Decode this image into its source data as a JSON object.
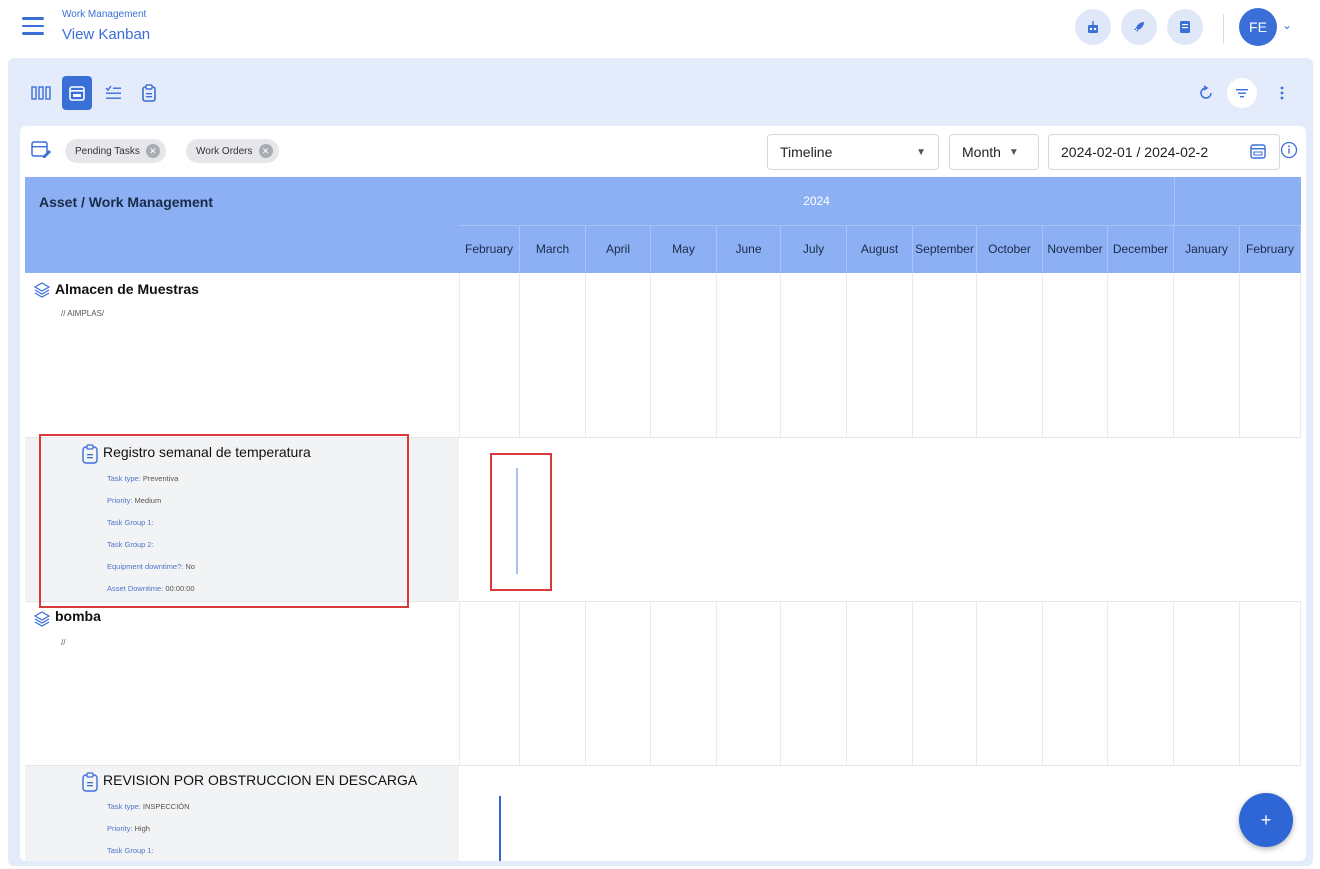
{
  "header": {
    "app_subtitle": "Work Management",
    "app_title": "View Kanban",
    "avatar_initials": "FE"
  },
  "filters": {
    "chips": [
      "Pending Tasks",
      "Work Orders"
    ],
    "view_select": "Timeline",
    "scale_select": "Month",
    "date_range": "2024-02-01 / 2024-02-2"
  },
  "grid": {
    "left_header": "Asset / Work Management",
    "year": "2024",
    "months": [
      "February",
      "March",
      "April",
      "May",
      "June",
      "July",
      "August",
      "September",
      "October",
      "November",
      "December",
      "January",
      "February"
    ]
  },
  "rows": {
    "asset1": {
      "name": "Almacen de Muestras",
      "path": "// AIMPLAS/"
    },
    "task1": {
      "name": "Registro semanal de temperatura",
      "details": [
        {
          "label": "Task type:",
          "value": "Preventiva"
        },
        {
          "label": "Priority:",
          "value": "Medium"
        },
        {
          "label": "Task Group 1:",
          "value": ""
        },
        {
          "label": "Task Group 2:",
          "value": ""
        },
        {
          "label": "Equipment downtime?:",
          "value": "No"
        },
        {
          "label": "Asset Downtime:",
          "value": "00:00:00"
        }
      ]
    },
    "asset2": {
      "name": "bomba",
      "path": "//"
    },
    "task2": {
      "name": "REVISION POR OBSTRUCCION EN DESCARGA",
      "details": [
        {
          "label": "Task type:",
          "value": "INSPECCIÓN"
        },
        {
          "label": "Priority:",
          "value": "High"
        },
        {
          "label": "Task Group 1:",
          "value": ""
        }
      ]
    }
  },
  "fab_label": "+",
  "colors": {
    "accent": "#3b6fd8",
    "header_bg": "#8cb0f3",
    "bar_light": "#a9c2f0",
    "bar_dark": "#2f66d6",
    "highlight": "#d93a3a"
  }
}
